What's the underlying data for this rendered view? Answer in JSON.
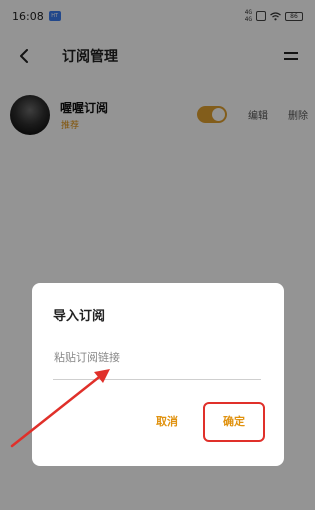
{
  "status_bar": {
    "time": "16:08",
    "app_badge": "HT",
    "signal": "4G\n4G",
    "battery": "86"
  },
  "header": {
    "title": "订阅管理",
    "back_icon": "chevron-left-icon",
    "menu_icon": "equals-icon"
  },
  "subscription": {
    "name": "喔喔订阅",
    "tag": "推荐",
    "enabled": true,
    "edit_label": "编辑",
    "delete_label": "删除"
  },
  "dialog": {
    "title": "导入订阅",
    "input_placeholder": "粘贴订阅链接",
    "input_value": "",
    "cancel_label": "取消",
    "confirm_label": "确定"
  },
  "colors": {
    "accent": "#e0920f",
    "toggle": "#e0a030",
    "annotation": "#e0302a"
  }
}
